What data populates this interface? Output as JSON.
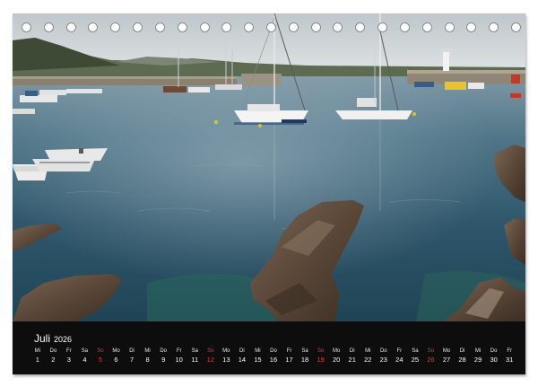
{
  "calendar": {
    "month": "Juli",
    "year": "2026",
    "sunday_color": "#e23b3b",
    "days": [
      {
        "wd": "Mi",
        "dn": "1",
        "sunday": false
      },
      {
        "wd": "Do",
        "dn": "2",
        "sunday": false
      },
      {
        "wd": "Fr",
        "dn": "3",
        "sunday": false
      },
      {
        "wd": "Sa",
        "dn": "4",
        "sunday": false
      },
      {
        "wd": "So",
        "dn": "5",
        "sunday": true
      },
      {
        "wd": "Mo",
        "dn": "6",
        "sunday": false
      },
      {
        "wd": "Di",
        "dn": "7",
        "sunday": false
      },
      {
        "wd": "Mi",
        "dn": "8",
        "sunday": false
      },
      {
        "wd": "Do",
        "dn": "9",
        "sunday": false
      },
      {
        "wd": "Fr",
        "dn": "10",
        "sunday": false
      },
      {
        "wd": "Sa",
        "dn": "11",
        "sunday": false
      },
      {
        "wd": "So",
        "dn": "12",
        "sunday": true
      },
      {
        "wd": "Mo",
        "dn": "13",
        "sunday": false
      },
      {
        "wd": "Di",
        "dn": "14",
        "sunday": false
      },
      {
        "wd": "Mi",
        "dn": "15",
        "sunday": false
      },
      {
        "wd": "Do",
        "dn": "16",
        "sunday": false
      },
      {
        "wd": "Fr",
        "dn": "17",
        "sunday": false
      },
      {
        "wd": "Sa",
        "dn": "18",
        "sunday": false
      },
      {
        "wd": "So",
        "dn": "19",
        "sunday": true
      },
      {
        "wd": "Mo",
        "dn": "20",
        "sunday": false
      },
      {
        "wd": "Di",
        "dn": "21",
        "sunday": false
      },
      {
        "wd": "Mi",
        "dn": "22",
        "sunday": false
      },
      {
        "wd": "Do",
        "dn": "23",
        "sunday": false
      },
      {
        "wd": "Fr",
        "dn": "24",
        "sunday": false
      },
      {
        "wd": "Sa",
        "dn": "25",
        "sunday": false
      },
      {
        "wd": "So",
        "dn": "26",
        "sunday": true
      },
      {
        "wd": "Mo",
        "dn": "27",
        "sunday": false
      },
      {
        "wd": "Di",
        "dn": "28",
        "sunday": false
      },
      {
        "wd": "Mi",
        "dn": "29",
        "sunday": false
      },
      {
        "wd": "Do",
        "dn": "30",
        "sunday": false
      },
      {
        "wd": "Fr",
        "dn": "31",
        "sunday": false
      }
    ]
  },
  "binding": {
    "ring_count": 23
  },
  "photo": {
    "sky_color": "#c9d1d6",
    "water_color": "#2c5266",
    "rock_color": "#5b4a3c"
  }
}
